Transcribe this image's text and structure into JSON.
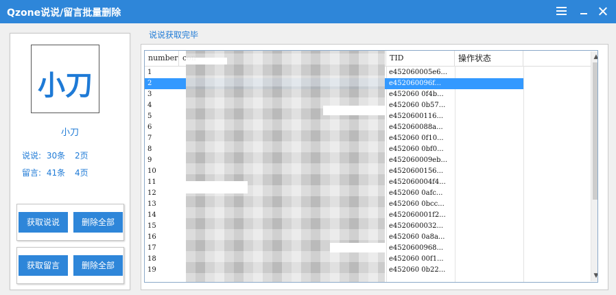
{
  "window": {
    "title": "Qzone说说/留言批量删除",
    "colors": {
      "accent": "#2e86d9",
      "selected_row": "#3399ff",
      "text_blue": "#1e7ad6"
    },
    "icons": {
      "menu": "menu-icon",
      "minimize": "minimize-icon",
      "close": "close-icon"
    }
  },
  "profile": {
    "avatar_text": "小刀",
    "name": "小刀",
    "shuoshuo_label": "说说:",
    "shuoshuo_count": "30条",
    "shuoshuo_pages": "2页",
    "liuyan_label": "留言:",
    "liuyan_count": "41条",
    "liuyan_pages": "4页"
  },
  "buttons": {
    "get_shuoshuo": "获取说说",
    "delete_all_1": "删除全部",
    "get_liuyan": "获取留言",
    "delete_all_2": "删除全部"
  },
  "status_text": "说说获取完毕",
  "table": {
    "columns": [
      "number",
      "con",
      "TID",
      "操作状态"
    ],
    "selected_index": 1,
    "rows": [
      {
        "number": "1",
        "tid": "e452060005e6..."
      },
      {
        "number": "2",
        "tid": "e452060096f..."
      },
      {
        "number": "3",
        "tid": "e452060 0f4b..."
      },
      {
        "number": "4",
        "tid": "e452060 0b57..."
      },
      {
        "number": "5",
        "tid": "e4520600116..."
      },
      {
        "number": "6",
        "tid": "e452060088a..."
      },
      {
        "number": "7",
        "tid": "e452060 0f10..."
      },
      {
        "number": "8",
        "tid": "e452060 0bf0..."
      },
      {
        "number": "9",
        "tid": "e452060009eb..."
      },
      {
        "number": "10",
        "tid": "e4520600156..."
      },
      {
        "number": "11",
        "tid": "e452060004f4..."
      },
      {
        "number": "12",
        "tid": "e452060 0afc..."
      },
      {
        "number": "13",
        "tid": "e452060 0bcc..."
      },
      {
        "number": "14",
        "tid": "e452060001f2..."
      },
      {
        "number": "15",
        "tid": "e4520600032..."
      },
      {
        "number": "16",
        "tid": "e452060 0a8a..."
      },
      {
        "number": "17",
        "tid": "e4520600968..."
      },
      {
        "number": "18",
        "tid": "e452060 00f1..."
      },
      {
        "number": "19",
        "tid": "e452060 0b22..."
      }
    ]
  }
}
